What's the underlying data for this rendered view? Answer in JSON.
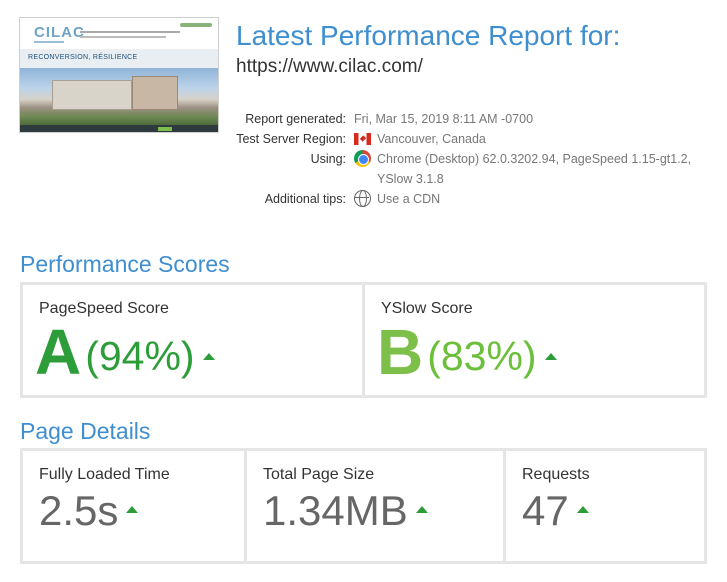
{
  "header": {
    "title": "Latest Performance Report for:",
    "url": "https://www.cilac.com/",
    "thumbnail": {
      "logo_text": "CILAC",
      "banner_text": "RECONVERSION, RÉSILIENCE"
    }
  },
  "report_info": {
    "generated_label": "Report generated:",
    "generated_value": "Fri, Mar 15, 2019 8:11 AM -0700",
    "region_label": "Test Server Region:",
    "region_value": "Vancouver, Canada",
    "region_icon": "canada-flag-icon",
    "using_label": "Using:",
    "using_value_line1": "Chrome (Desktop) 62.0.3202.94, PageSpeed 1.15-gt1.2,",
    "using_value_line2": "YSlow 3.1.8",
    "using_icon": "chrome-icon",
    "tips_label": "Additional tips:",
    "tips_value": "Use a CDN",
    "tips_icon": "globe-icon"
  },
  "performance": {
    "heading": "Performance Scores",
    "pagespeed": {
      "label": "PageSpeed Score",
      "grade": "A",
      "percent": "(94%)",
      "color": "#2d9d3a",
      "trend_icon": "up-arrow-icon"
    },
    "yslow": {
      "label": "YSlow Score",
      "grade": "B",
      "percent": "(83%)",
      "color": "#6cbf3a",
      "trend_icon": "up-arrow-icon"
    }
  },
  "details": {
    "heading": "Page Details",
    "load_time": {
      "label": "Fully Loaded Time",
      "value": "2.5s",
      "trend_icon": "up-arrow-icon"
    },
    "page_size": {
      "label": "Total Page Size",
      "value": "1.34MB",
      "trend_icon": "up-arrow-icon"
    },
    "requests": {
      "label": "Requests",
      "value": "47",
      "trend_icon": "up-arrow-icon"
    }
  },
  "colors": {
    "accent": "#3e8ed0",
    "up_arrow": "#2d9d3a"
  }
}
